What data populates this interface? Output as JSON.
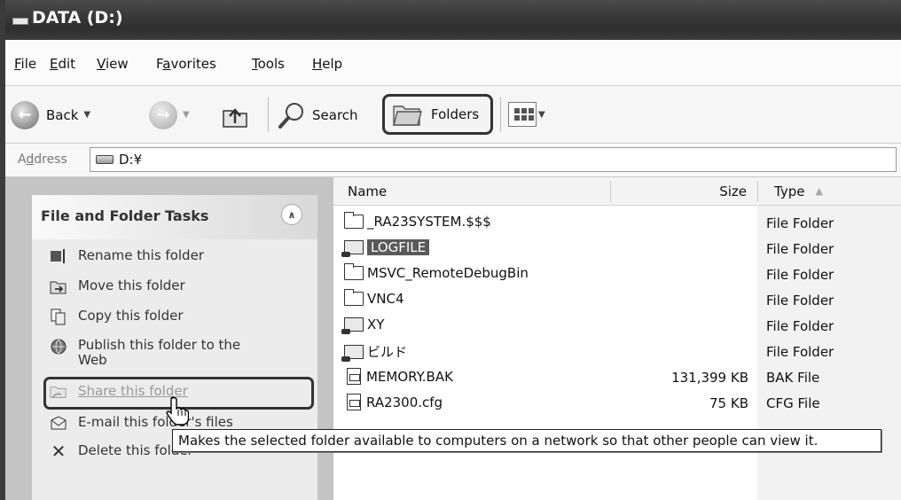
{
  "window": {
    "title": "DATA (D:)"
  },
  "menu": [
    {
      "label": "File",
      "ul": "F",
      "rest": "ile"
    },
    {
      "label": "Edit",
      "ul": "E",
      "rest": "dit"
    },
    {
      "label": "View",
      "ul": "V",
      "rest": "iew"
    },
    {
      "label": "Favorites",
      "pre": "F",
      "ul": "a",
      "rest": "vorites"
    },
    {
      "label": "Tools",
      "ul": "T",
      "rest": "ools"
    },
    {
      "label": "Help",
      "ul": "H",
      "rest": "elp"
    }
  ],
  "toolbar": {
    "back_label": "Back",
    "search_label": "Search",
    "folders_label": "Folders"
  },
  "address": {
    "label": "Address",
    "label_pre": "A",
    "label_ul": "d",
    "label_rest": "dress",
    "value": "D:¥"
  },
  "tasks_panel": {
    "title": "File and Folder Tasks",
    "items": [
      {
        "label": "Rename this folder",
        "icon": "rename-icon"
      },
      {
        "label": "Move this folder",
        "icon": "move-icon"
      },
      {
        "label": "Copy this folder",
        "icon": "copy-icon"
      },
      {
        "label": "Publish this folder to the Web",
        "icon": "publish-icon"
      },
      {
        "label": "Share this folder",
        "icon": "share-icon"
      },
      {
        "label": "E-mail this folder's files",
        "icon": "email-icon"
      },
      {
        "label": "Delete this folder",
        "icon": "delete-icon"
      }
    ]
  },
  "file_list": {
    "columns": {
      "name": "Name",
      "size": "Size",
      "type": "Type"
    },
    "rows": [
      {
        "name": "_RA23SYSTEM.$$$",
        "size": "",
        "type": "File Folder",
        "icon": "folder-icon"
      },
      {
        "name": "LOGFILE",
        "size": "",
        "type": "File Folder",
        "icon": "shared-folder-icon",
        "selected": true
      },
      {
        "name": "MSVC_RemoteDebugBin",
        "size": "",
        "type": "File Folder",
        "icon": "folder-icon"
      },
      {
        "name": "VNC4",
        "size": "",
        "type": "File Folder",
        "icon": "folder-icon"
      },
      {
        "name": "XY",
        "size": "",
        "type": "File Folder",
        "icon": "shared-folder-icon"
      },
      {
        "name": "ビルド",
        "size": "",
        "type": "File Folder",
        "icon": "shared-folder-icon"
      },
      {
        "name": "MEMORY.BAK",
        "size": "131,399 KB",
        "type": "BAK File",
        "icon": "file-icon"
      },
      {
        "name": "RA2300.cfg",
        "size": "75 KB",
        "type": "CFG File",
        "icon": "file-icon"
      }
    ]
  },
  "tooltip": {
    "text": "Makes the selected folder available to computers on a network so that other people can view it."
  }
}
